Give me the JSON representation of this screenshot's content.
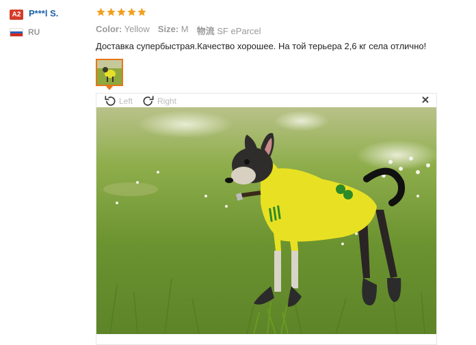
{
  "reviewer": {
    "level_badge": "A2",
    "name": "P***l S.",
    "country_code": "RU"
  },
  "rating": {
    "stars": 5,
    "max": 5,
    "color": "#f0a01e"
  },
  "attributes": {
    "color_label": "Color:",
    "color_value": "Yellow",
    "size_label": "Size:",
    "size_value": "M",
    "shipping_label": "物流",
    "shipping_value": "SF eParcel"
  },
  "review_text": "Доставка супербыстрая.Качество хорошее. На той терьера 2,6 кг села отлично!",
  "viewer": {
    "rotate_left_label": "Left",
    "rotate_right_label": "Right"
  },
  "colors": {
    "accent": "#e8751a",
    "name_link": "#1a5fa8",
    "badge": "#d43c2a"
  }
}
